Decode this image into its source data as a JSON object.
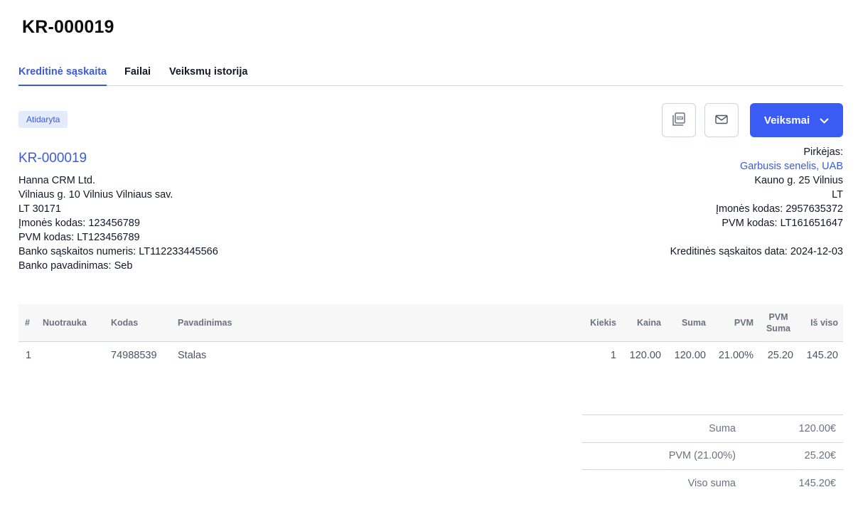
{
  "page": {
    "title": "KR-000019"
  },
  "tabs": [
    {
      "label": "Kreditinė sąskaita",
      "active": true
    },
    {
      "label": "Failai",
      "active": false
    },
    {
      "label": "Veiksmų istorija",
      "active": false
    }
  ],
  "status": {
    "label": "Atidaryta"
  },
  "toolbar": {
    "pdf_icon": "pdf-file-icon",
    "mail_icon": "envelope-icon",
    "actions_label": "Veiksmai",
    "actions_icon": "chevron-down-icon"
  },
  "seller": {
    "doc_number": "KR-000019",
    "lines": [
      "Hanna CRM Ltd.",
      "Vilniaus g. 10 Vilnius Vilniaus sav.",
      "LT 30171",
      "Įmonės kodas: 123456789",
      "PVM kodas: LT123456789",
      "Banko sąskaitos numeris: LT112233445566",
      "Banko pavadinimas: Seb"
    ]
  },
  "buyer": {
    "heading": "Pirkėjas:",
    "name": "Garbusis senelis, UAB",
    "lines": [
      "Kauno g. 25 Vilnius",
      "LT",
      "Įmonės kodas: 2957635372",
      "PVM kodas: LT161651647"
    ],
    "date_line": "Kreditinės sąskaitos data: 2024-12-03"
  },
  "table": {
    "headers": {
      "index": "#",
      "photo": "Nuotrauka",
      "code": "Kodas",
      "name": "Pavadinimas",
      "qty": "Kiekis",
      "price": "Kaina",
      "sum": "Suma",
      "vat": "PVM",
      "vat_sum_1": "PVM",
      "vat_sum_2": "Suma",
      "total": "Iš viso"
    },
    "rows": [
      {
        "index": "1",
        "photo": "",
        "code": "74988539",
        "name": "Stalas",
        "qty": "1",
        "price": "120.00",
        "sum": "120.00",
        "vat": "21.00%",
        "vat_sum": "25.20",
        "total": "145.20"
      }
    ]
  },
  "totals": {
    "sum_label": "Suma",
    "sum_value": "120.00€",
    "vat_label": "PVM (21.00%)",
    "vat_value": "25.20€",
    "grand_label": "Viso suma",
    "grand_value": "145.20€"
  },
  "colors": {
    "accent": "#3b5bdb",
    "button": "#3b5bf5",
    "badge_bg": "#e3ebfd"
  }
}
